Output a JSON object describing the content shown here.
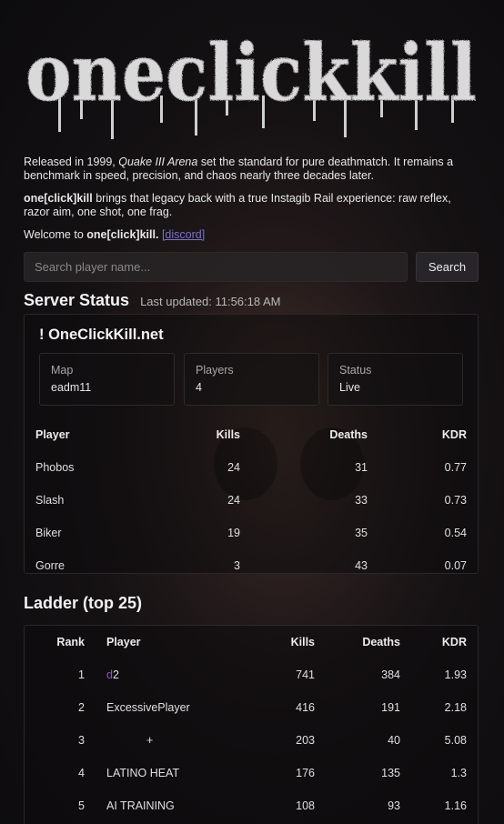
{
  "site": {
    "logo_text": "oneclickkill",
    "logo_color": "#d9d9d9"
  },
  "intro": {
    "p1_a": "Released in 1999, ",
    "p1_game": "Quake III Arena",
    "p1_b": " set the standard for pure deathmatch. It remains a benchmark in speed, precision, and chaos nearly three decades later.",
    "p2_brand": "one[click]kill",
    "p2_text": " brings that legacy back with a true Instagib Rail experience: raw reflex, razor aim, one shot, one frag.",
    "p3_a": "Welcome to ",
    "p3_brand": "one[click]kill.",
    "p3_link": "[discord]"
  },
  "search": {
    "placeholder": "Search player name...",
    "button_label": "Search"
  },
  "server_status": {
    "heading": "Server Status",
    "last_updated": "Last updated: 11:56:18 AM",
    "server_name": "! OneClickKill.net",
    "stats": [
      {
        "label": "Map",
        "value": "eadm11"
      },
      {
        "label": "Players",
        "value": "4"
      },
      {
        "label": "Status",
        "value": "Live"
      }
    ],
    "columns": [
      "Player",
      "Kills",
      "Deaths",
      "KDR"
    ],
    "rows": [
      {
        "player": "Phobos",
        "kills": "24",
        "deaths": "31",
        "kdr": "0.77"
      },
      {
        "player": "Slash",
        "kills": "24",
        "deaths": "33",
        "kdr": "0.73"
      },
      {
        "player": "Biker",
        "kills": "19",
        "deaths": "35",
        "kdr": "0.54"
      },
      {
        "player": "Gorre",
        "kills": "3",
        "deaths": "43",
        "kdr": "0.07"
      }
    ]
  },
  "ladder": {
    "heading": "Ladder (top 25)",
    "columns": [
      "Rank",
      "Player",
      "Kills",
      "Deaths",
      "KDR"
    ],
    "rows": [
      {
        "rank": "1",
        "player_prefix": "d",
        "player": "2",
        "kills": "741",
        "deaths": "384",
        "kdr": "1.93"
      },
      {
        "rank": "2",
        "player_prefix": "",
        "player": "ExcessivePlayer",
        "kills": "416",
        "deaths": "191",
        "kdr": "2.18"
      },
      {
        "rank": "3",
        "player_prefix": "",
        "player": "+",
        "kills": "203",
        "deaths": "40",
        "kdr": "5.08"
      },
      {
        "rank": "4",
        "player_prefix": "",
        "player": "LATINO HEAT",
        "kills": "176",
        "deaths": "135",
        "kdr": "1.3"
      },
      {
        "rank": "5",
        "player_prefix": "",
        "player": "AI TRAINING",
        "kills": "108",
        "deaths": "93",
        "kdr": "1.16"
      }
    ]
  }
}
